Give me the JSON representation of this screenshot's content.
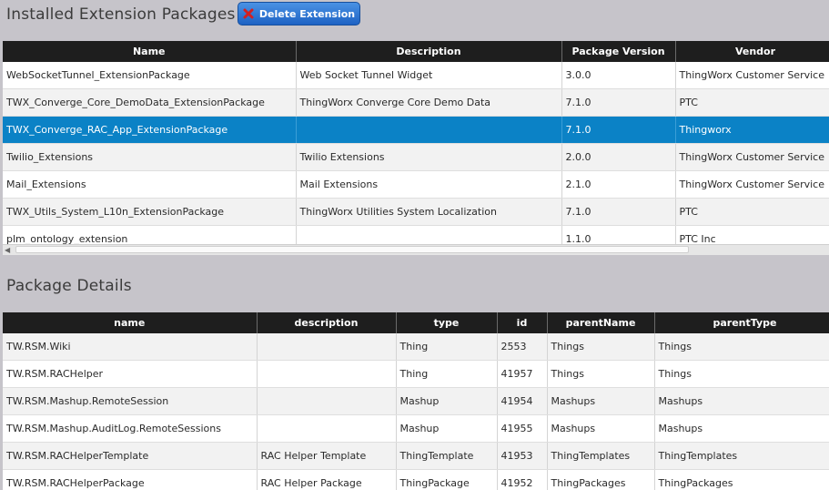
{
  "extensions_section": {
    "title": "Installed Extension Packages",
    "delete_button_label": "Delete Extension",
    "columns": [
      "Name",
      "Description",
      "Package Version",
      "Vendor"
    ],
    "rows": [
      [
        "WebSocketTunnel_ExtensionPackage",
        "Web Socket Tunnel Widget",
        "3.0.0",
        "ThingWorx Customer Service"
      ],
      [
        "TWX_Converge_Core_DemoData_ExtensionPackage",
        "ThingWorx Converge Core Demo Data",
        "7.1.0",
        "PTC"
      ],
      [
        "TWX_Converge_RAC_App_ExtensionPackage",
        "",
        "7.1.0",
        "Thingworx"
      ],
      [
        "Twilio_Extensions",
        "Twilio Extensions",
        "2.0.0",
        "ThingWorx Customer Service"
      ],
      [
        "Mail_Extensions",
        "Mail Extensions",
        "2.1.0",
        "ThingWorx Customer Service"
      ],
      [
        "TWX_Utils_System_L10n_ExtensionPackage",
        "ThingWorx Utilities System Localization",
        "7.1.0",
        "PTC"
      ],
      [
        "plm_ontology_extension",
        "",
        "1.1.0",
        "PTC Inc"
      ]
    ],
    "selected_row": 2
  },
  "details_section": {
    "title": "Package Details",
    "columns": [
      "name",
      "description",
      "type",
      "id",
      "parentName",
      "parentType"
    ],
    "rows": [
      [
        "TW.RSM.Wiki",
        "",
        "Thing",
        "2553",
        "Things",
        "Things"
      ],
      [
        "TW.RSM.RACHelper",
        "",
        "Thing",
        "41957",
        "Things",
        "Things"
      ],
      [
        "TW.RSM.Mashup.RemoteSession",
        "",
        "Mashup",
        "41954",
        "Mashups",
        "Mashups"
      ],
      [
        "TW.RSM.Mashup.AuditLog.RemoteSessions",
        "",
        "Mashup",
        "41955",
        "Mashups",
        "Mashups"
      ],
      [
        "TW.RSM.RACHelperTemplate",
        "RAC Helper Template",
        "ThingTemplate",
        "41953",
        "ThingTemplates",
        "ThingTemplates"
      ],
      [
        "TW.RSM.RACHelperPackage",
        "RAC Helper Package",
        "ThingPackage",
        "41952",
        "ThingPackages",
        "ThingPackages"
      ]
    ]
  },
  "colors": {
    "header_bg": "#1e1e1e",
    "selected_row_bg": "#0b82c6",
    "button_blue": "#2f7bd8",
    "delete_icon": "#d42020"
  }
}
